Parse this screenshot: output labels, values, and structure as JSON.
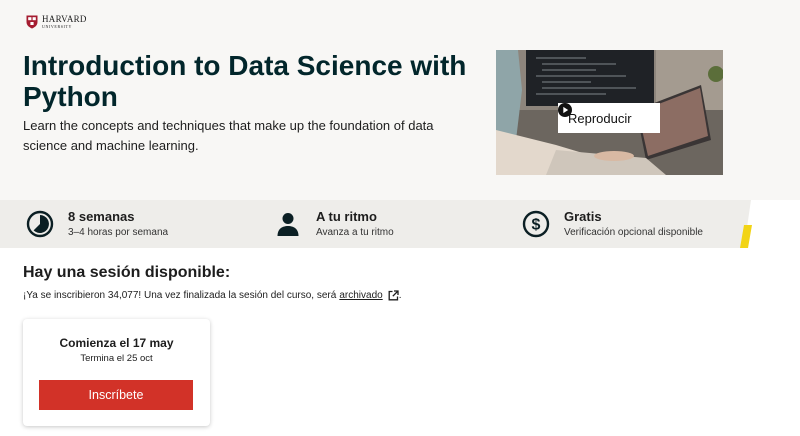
{
  "logo": {
    "name": "HARVARD",
    "sub": "UNIVERSITY"
  },
  "course": {
    "title": "Introduction to Data Science with Python",
    "subtitle": "Learn the concepts and techniques that make up the foundation of data science and machine learning."
  },
  "video": {
    "play_label": "Reproducir"
  },
  "facts": [
    {
      "title": "8 semanas",
      "sub": "3–4 horas por semana",
      "icon": "clock-pie-icon"
    },
    {
      "title": "A tu ritmo",
      "sub": "Avanza a tu ritmo",
      "icon": "person-icon"
    },
    {
      "title": "Gratis",
      "sub": "Verificación opcional disponible",
      "icon": "dollar-icon"
    }
  ],
  "session": {
    "heading": "Hay una sesión disponible:",
    "note": "¡Ya se inscribieron 34,077! Una vez finalizada la sesión del curso, será",
    "link": "archivado",
    "period": ".",
    "start": "Comienza el 17 may",
    "end": "Termina el 25 oct",
    "enroll_label": "Inscríbete"
  },
  "colors": {
    "title": "#02262b",
    "band": "#eeedea",
    "accent_yellow": "#f2d416",
    "enroll": "#d23228",
    "hero_bg": "#f8f7f5"
  }
}
